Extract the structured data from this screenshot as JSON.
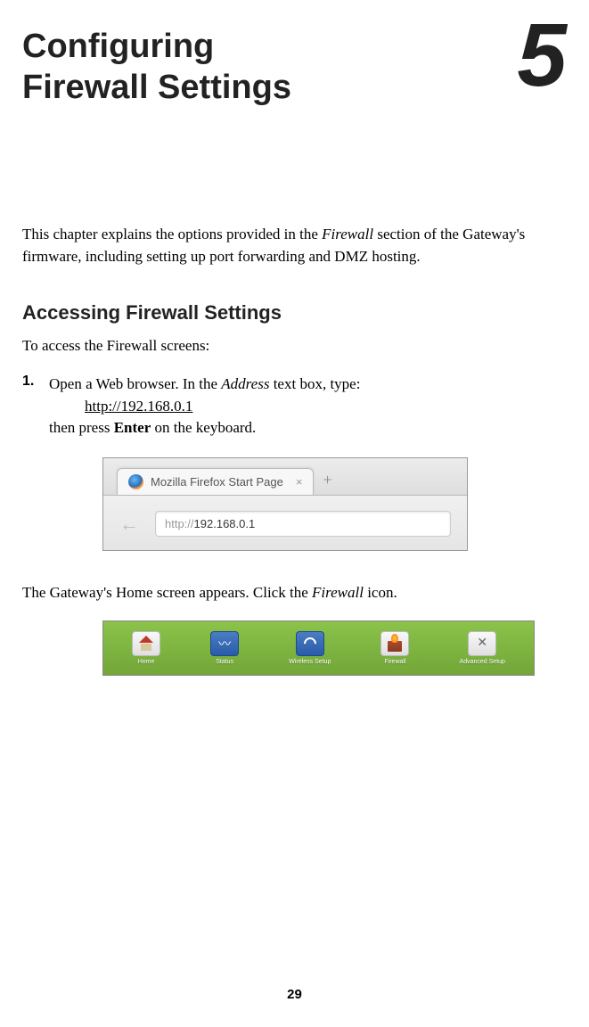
{
  "chapter": {
    "title_line1": "Configuring",
    "title_line2": "Firewall Settings",
    "number": "5"
  },
  "intro": {
    "pre": "This chapter explains the options provided in the ",
    "em": "Firewall",
    "post": " section of the Gateway's firmware, including setting up port forwarding and DMZ hosting."
  },
  "section_heading": "Accessing Firewall Settings",
  "lead": "To access the Firewall screens:",
  "step1": {
    "num": "1.",
    "pre": "Open a Web browser. In the ",
    "em": "Address",
    "mid": " text box, type:",
    "url": "http://192.168.0.1",
    "post_a": "then press ",
    "post_b": "Enter",
    "post_c": " on the keyboard."
  },
  "browser": {
    "tab_label": "Mozilla Firefox Start Page",
    "url_prefix": "http://",
    "url_host": "192.168.0.1"
  },
  "result": {
    "pre": "The Gateway's Home screen appears. Click the ",
    "em": "Firewall",
    "post": " icon."
  },
  "gateway_nav": {
    "items": [
      {
        "label": "Home"
      },
      {
        "label": "Status"
      },
      {
        "label": "Wireless Setup"
      },
      {
        "label": "Firewall"
      },
      {
        "label": "Advanced Setup"
      }
    ]
  },
  "page_number": "29"
}
